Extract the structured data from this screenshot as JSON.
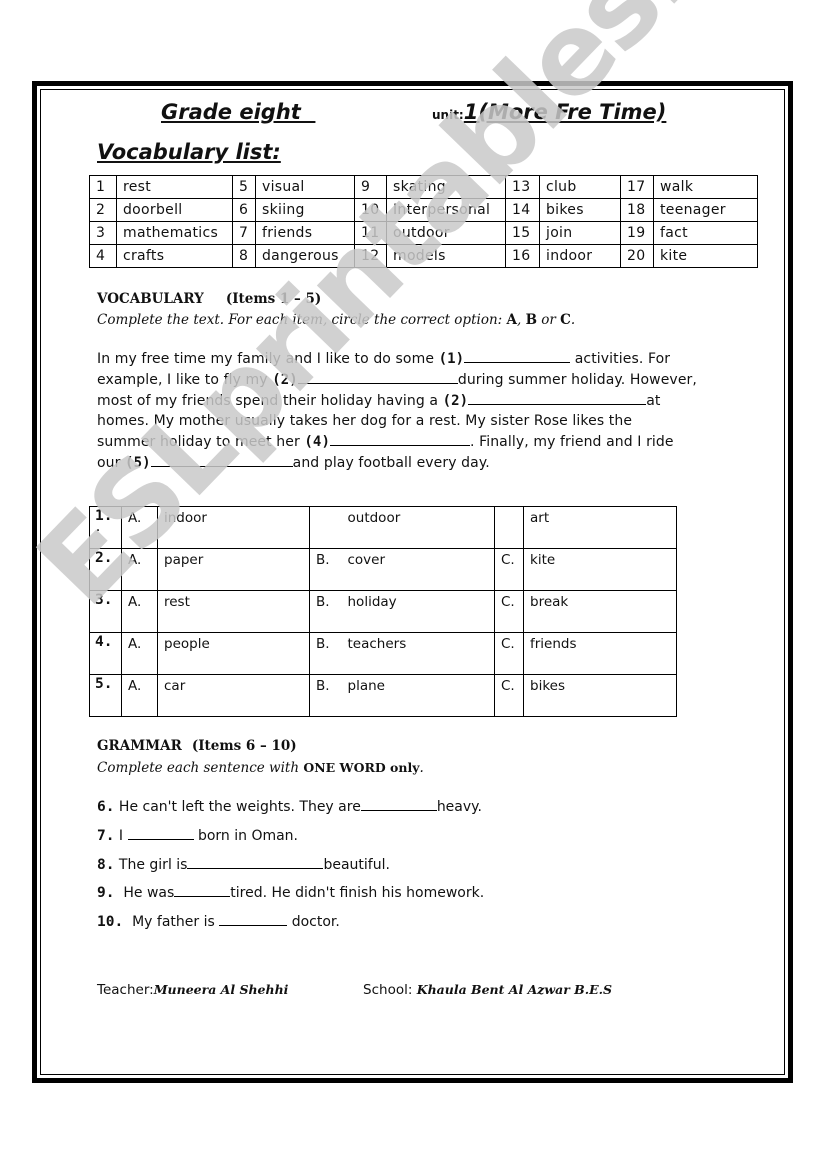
{
  "header": {
    "grade": "Grade eight  ",
    "unit_label": "unit:",
    "unit_value": "1(More Fre Time)",
    "vocab_title": "Vocabulary list:"
  },
  "vocab_list": [
    [
      {
        "n": "1",
        "w": "rest"
      },
      {
        "n": "5",
        "w": "visual"
      },
      {
        "n": "9",
        "w": "skating"
      },
      {
        "n": "13",
        "w": "club"
      },
      {
        "n": "17",
        "w": "walk"
      }
    ],
    [
      {
        "n": "2",
        "w": "doorbell"
      },
      {
        "n": "6",
        "w": "skiing"
      },
      {
        "n": "10",
        "w": "Interpersonal"
      },
      {
        "n": "14",
        "w": "bikes"
      },
      {
        "n": "18",
        "w": "teenager"
      }
    ],
    [
      {
        "n": "3",
        "w": "mathematics"
      },
      {
        "n": "7",
        "w": "friends"
      },
      {
        "n": "11",
        "w": "outdoor"
      },
      {
        "n": "15",
        "w": "join"
      },
      {
        "n": "19",
        "w": "fact"
      }
    ],
    [
      {
        "n": "4",
        "w": "crafts"
      },
      {
        "n": "8",
        "w": "dangerous"
      },
      {
        "n": "12",
        "w": "models"
      },
      {
        "n": "16",
        "w": "indoor"
      },
      {
        "n": "20",
        "w": "kite"
      }
    ]
  ],
  "vocabulary_section": {
    "heading": "VOCABULARY",
    "items": "(Items 1 – 5)",
    "instruction_prefix": "Complete the text. For each item, circle the correct option: ",
    "opt_a": "A",
    "sep1": ", ",
    "opt_b": "B",
    "sep2": " or ",
    "opt_c": "C",
    "end": ".",
    "paragraph": {
      "l1a": "In my free time my family and I like to do some ",
      "m1": "(1)",
      "l1b": " activities. For",
      "l2a": "example, I like to fly my ",
      "m2": "(2)",
      "l2b": "during summer holiday. However,",
      "l3a": "most of my friends spend their holiday having a ",
      "m3": "(2)",
      "l3b": "at",
      "l4": "homes. My mother usually takes her dog for a rest. My sister Rose likes the",
      "l5a": "summer holiday to meet her ",
      "m4": "(4)",
      "l5b": ". Finally, my friend and I ride",
      "l6a": "our ",
      "m5": "(5)",
      "l6b": "and play football every day."
    },
    "options": [
      {
        "num": "1.",
        "sub": ".",
        "a_label": "A.",
        "a": "indoor",
        "b_label": "",
        "b": "outdoor",
        "c_label": "",
        "c": "art"
      },
      {
        "num": "2.",
        "sub": "",
        "a_label": "A.",
        "a": "paper",
        "b_label": "B.",
        "b": "cover",
        "c_label": "C.",
        "c": "kite"
      },
      {
        "num": "3.",
        "sub": "",
        "a_label": "A.",
        "a": "rest",
        "b_label": "B.",
        "b": "holiday",
        "c_label": "C.",
        "c": "break"
      },
      {
        "num": "4.",
        "sub": "",
        "a_label": "A.",
        "a": "people",
        "b_label": "B.",
        "b": "teachers",
        "c_label": "C.",
        "c": "friends"
      },
      {
        "num": "5.",
        "sub": "",
        "a_label": "A.",
        "a": "car",
        "b_label": "B.",
        "b": "plane",
        "c_label": "C.",
        "c": "bikes"
      }
    ]
  },
  "grammar_section": {
    "heading": "GRAMMAR",
    "items": "(Items 6 – 10)",
    "instruction_prefix": "Complete each sentence with ",
    "instruction_bold": "ONE WORD only",
    "end": ".",
    "questions": [
      {
        "num": "6.",
        "before": " He can't left the weights. They are",
        "after": "heavy."
      },
      {
        "num": "7.",
        "before": " I ",
        "after": " born in Oman."
      },
      {
        "num": "8.",
        "before": " The girl is",
        "after": "beautiful."
      },
      {
        "num": "9.",
        "before": "  He was",
        "after": "tired. He didn't finish his homework."
      },
      {
        "num": "10.",
        "before": "  My father is ",
        "after": " doctor."
      }
    ]
  },
  "footer": {
    "teacher_label": "Teacher:",
    "teacher_name": "Muneera Al Shehhi",
    "school_label": "School: ",
    "school_name": "Khaula Bent Al Azwar B.E.S"
  },
  "watermark": "ESLprintables.com"
}
